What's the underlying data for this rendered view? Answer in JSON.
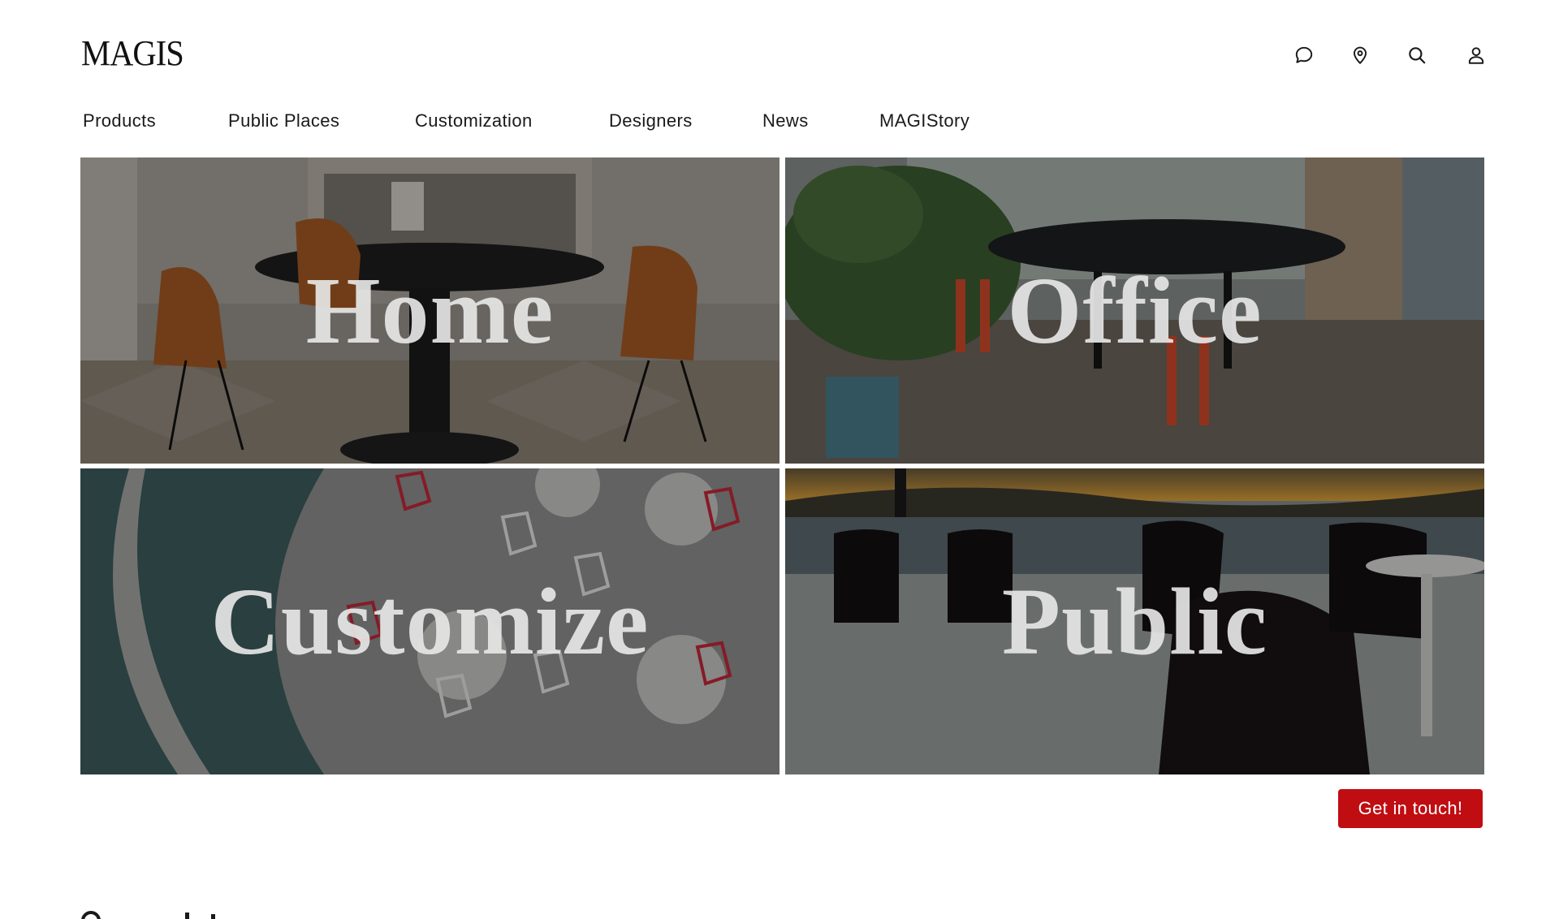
{
  "brand": {
    "logo_text": "MAGIS"
  },
  "header_icons": [
    "chat-icon",
    "location-pin-icon",
    "search-icon",
    "user-icon"
  ],
  "nav": {
    "items": [
      {
        "label": "Products"
      },
      {
        "label": "Public Places"
      },
      {
        "label": "Customization"
      },
      {
        "label": "Designers"
      },
      {
        "label": "News"
      },
      {
        "label": "MAGIStory"
      }
    ]
  },
  "tiles": [
    {
      "label": "Home"
    },
    {
      "label": "Office"
    },
    {
      "label": "Customize"
    },
    {
      "label": "Public"
    }
  ],
  "cta": {
    "label": "Get in touch!"
  },
  "colors": {
    "accent": "#c00d12",
    "text": "#1a1a1a",
    "background": "#ffffff"
  }
}
